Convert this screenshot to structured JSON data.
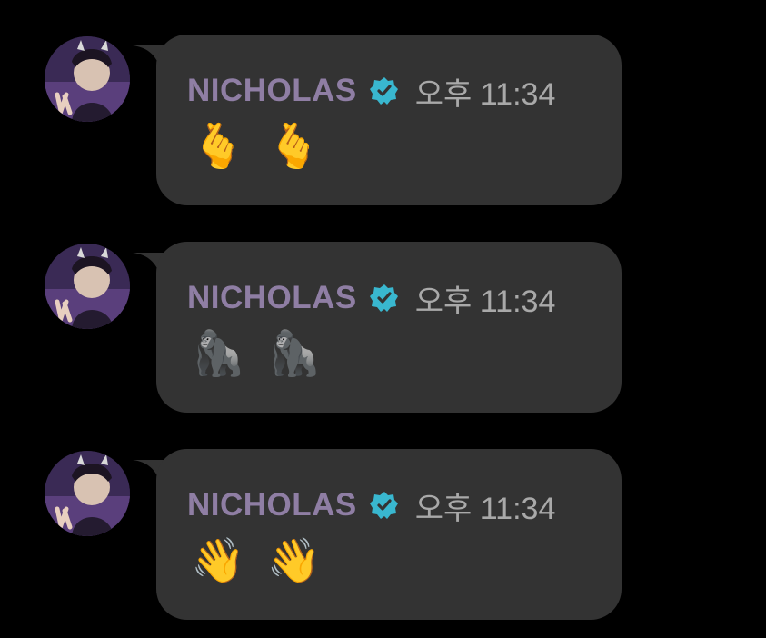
{
  "colors": {
    "background": "#000000",
    "bubble": "#333333",
    "name": "#8f7ea4",
    "time": "#a9a9a9",
    "verified": "#39b7cf"
  },
  "messages": [
    {
      "sender": "NICHOLAS",
      "verified_icon": "verified-badge-icon",
      "time": "오후 11:34",
      "emojis": [
        "🫰",
        "🫰"
      ]
    },
    {
      "sender": "NICHOLAS",
      "verified_icon": "verified-badge-icon",
      "time": "오후 11:34",
      "emojis": [
        "🦍",
        "🦍"
      ]
    },
    {
      "sender": "NICHOLAS",
      "verified_icon": "verified-badge-icon",
      "time": "오후 11:34",
      "emojis": [
        "👋",
        "👋"
      ]
    }
  ]
}
